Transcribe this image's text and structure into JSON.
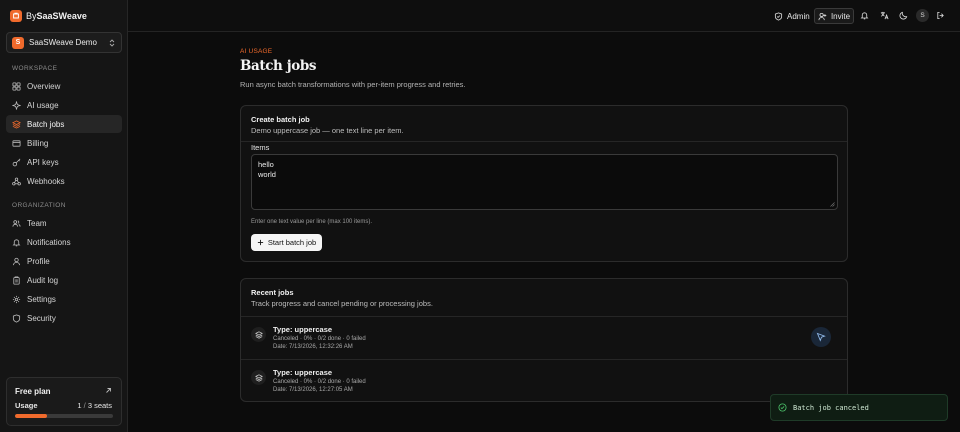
{
  "brand": {
    "prefix": "By",
    "name": "SaaSWeave",
    "accent": "#f06a2c"
  },
  "org": {
    "badge": "S",
    "name": "SaaSWeave Demo"
  },
  "sidebar": {
    "workspace_label": "WORKSPACE",
    "workspace_items": [
      {
        "label": "Overview",
        "icon": "grid-icon"
      },
      {
        "label": "AI usage",
        "icon": "sparkles-icon"
      },
      {
        "label": "Batch jobs",
        "icon": "layers-icon",
        "active": true
      },
      {
        "label": "Billing",
        "icon": "credit-card-icon"
      },
      {
        "label": "API keys",
        "icon": "key-icon"
      },
      {
        "label": "Webhooks",
        "icon": "webhook-icon"
      }
    ],
    "organization_label": "ORGANIZATION",
    "organization_items": [
      {
        "label": "Team",
        "icon": "users-icon"
      },
      {
        "label": "Notifications",
        "icon": "bell-icon"
      },
      {
        "label": "Profile",
        "icon": "user-icon"
      },
      {
        "label": "Audit log",
        "icon": "clipboard-icon"
      },
      {
        "label": "Settings",
        "icon": "gear-icon"
      },
      {
        "label": "Security",
        "icon": "shield-icon"
      }
    ]
  },
  "plan": {
    "title": "Free plan",
    "usage_label": "Usage",
    "used": "1",
    "separator": "/",
    "total": "3 seats",
    "usage_fraction": 0.33
  },
  "topbar": {
    "admin_label": "Admin",
    "invite_label": "Invite",
    "avatar_initial": "S"
  },
  "page": {
    "eyebrow": "AI USAGE",
    "title": "Batch jobs",
    "subtitle": "Run async batch transformations with per-item progress and retries."
  },
  "create": {
    "title": "Create batch job",
    "description": "Demo uppercase job — one text line per item.",
    "items_label": "Items",
    "items_lines": [
      "hello",
      "world"
    ],
    "help": "Enter one text value per line (max 100 items).",
    "start_label": "Start batch job"
  },
  "recent": {
    "title": "Recent jobs",
    "description": "Track progress and cancel pending or processing jobs.",
    "jobs": [
      {
        "type": "Type: uppercase",
        "status": "Canceled · 0% · 0/2 done · 0 failed",
        "date": "Date: 7/13/2026, 12:32:26 AM"
      },
      {
        "type": "Type: uppercase",
        "status": "Canceled · 0% · 0/2 done · 0 failed",
        "date": "Date: 7/13/2026, 12:27:05 AM"
      }
    ]
  },
  "toast": {
    "message": "Batch job canceled",
    "color": "#4cc26a"
  }
}
